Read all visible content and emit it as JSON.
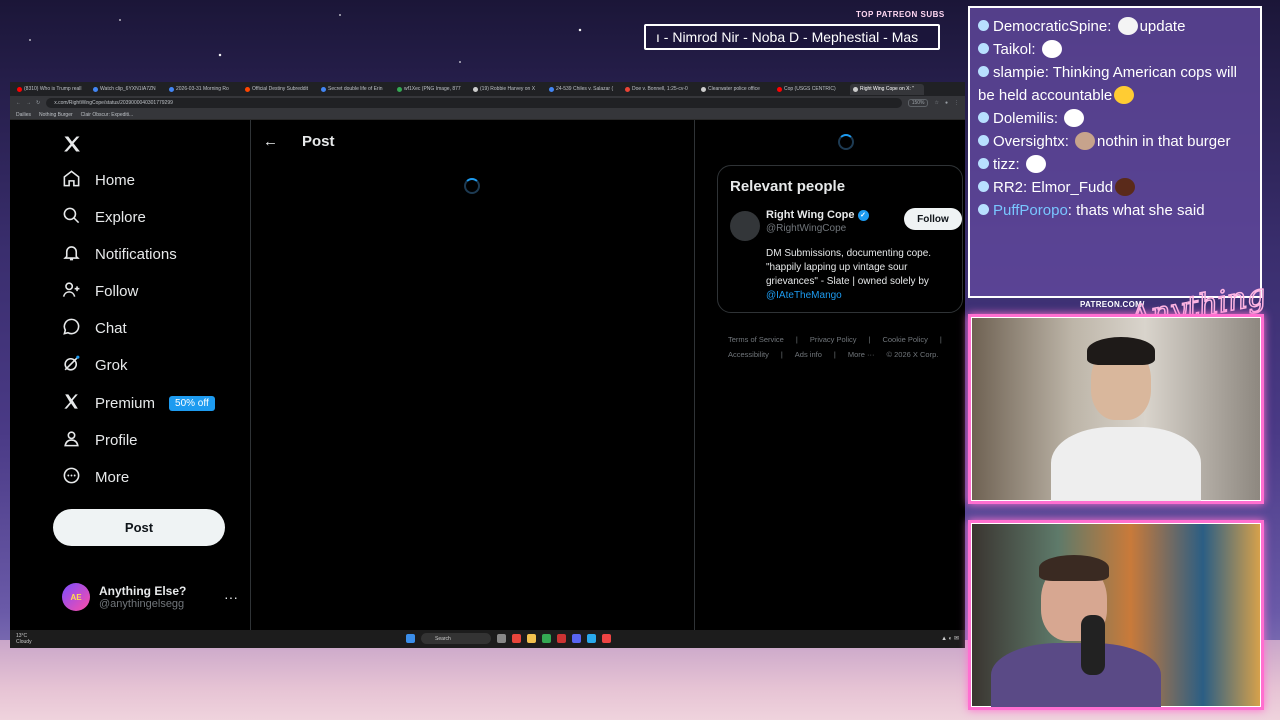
{
  "overlay": {
    "patreon_top_label": "TOP PATREON SUBS",
    "patreon_ticker": "ı - Nimrod Nir - Noba D - Mephestial - Mas",
    "patreon_url": "PATREON.COM/",
    "logo_text": "Anything Else?"
  },
  "browser": {
    "tabs": [
      {
        "label": "(8310) Who is Trump reall",
        "color": "#ff0000"
      },
      {
        "label": "Watch clip_6YXN1IA7ZN",
        "color": "#4285f4"
      },
      {
        "label": "2026-03-31 Morning Ro",
        "color": "#4285f4"
      },
      {
        "label": "Official Destiny Subreddit",
        "color": "#ff4500"
      },
      {
        "label": "Secret double life of Erin",
        "color": "#4285f4"
      },
      {
        "label": "wf1Xec (PNG Image, 877",
        "color": "#34a853"
      },
      {
        "label": "(19) Robbie Harvey on X",
        "color": "#cccccc"
      },
      {
        "label": "24-539 Chiles v. Salazar (",
        "color": "#4285f4"
      },
      {
        "label": "Doe v. Bonnell, 1:25-cv-0",
        "color": "#ea4335"
      },
      {
        "label": "Clearwater police office ",
        "color": "#cccccc"
      },
      {
        "label": "Cop (USGS CENTRIC)",
        "color": "#ff0000"
      },
      {
        "label": "Right Wing Cope on X: \"",
        "color": "#cccccc",
        "active": true
      }
    ],
    "url": "x.com/RightWingCope/status/2039000040301779299",
    "zoom": "150%",
    "bookmarks": [
      "Dailies",
      "Nothing Burger",
      "Clair Obscur: Expediti..."
    ]
  },
  "x": {
    "nav": [
      {
        "label": "Home",
        "icon": "home-icon"
      },
      {
        "label": "Explore",
        "icon": "search-icon"
      },
      {
        "label": "Notifications",
        "icon": "bell-icon"
      },
      {
        "label": "Follow",
        "icon": "follow-icon"
      },
      {
        "label": "Chat",
        "icon": "chat-icon"
      },
      {
        "label": "Grok",
        "icon": "grok-icon"
      },
      {
        "label": "Premium",
        "icon": "x-premium-icon",
        "badge": "50% off"
      },
      {
        "label": "Profile",
        "icon": "profile-icon"
      },
      {
        "label": "More",
        "icon": "more-icon"
      }
    ],
    "post_button": "Post",
    "account": {
      "name": "Anything Else?",
      "handle": "@anythingelsegg",
      "avatar_text": "AE"
    },
    "header_title": "Post",
    "relevant": {
      "title": "Relevant people",
      "name": "Right Wing Cope",
      "handle": "@RightWingCope",
      "follow": "Follow",
      "bio": "DM Submissions, documenting cope. \"happily lapping up vintage sour grievances\" - Slate | owned solely by",
      "mention": "@IAteTheMango"
    },
    "footer": [
      "Terms of Service",
      "|",
      "Privacy Policy",
      "|",
      "Cookie Policy",
      "|",
      "Accessibility",
      "|",
      "Ads info",
      "|",
      "More ···",
      "© 2026 X Corp."
    ]
  },
  "taskbar": {
    "weather_temp": "13°C",
    "weather_desc": "Cloudy",
    "search": "Search"
  },
  "chat": [
    {
      "user": "DemocraticSpine",
      "text": "update",
      "emote_before": true,
      "emote_color": "#f4f4f4"
    },
    {
      "user": "Taikol",
      "text": "",
      "emote_before": true,
      "emote_color": "#ffffff"
    },
    {
      "user": "slampie",
      "text": "Thinking American cops will be held accountable",
      "emote_after": true,
      "emote_color": "#ffcc33"
    },
    {
      "user": "Dolemilis",
      "text": "",
      "emote_before": true,
      "emote_color": "#ffffff"
    },
    {
      "user": "Oversightx",
      "text": "nothin in that burger",
      "emote_before": true,
      "emote_color": "#c7a38c"
    },
    {
      "user": "tizz",
      "text": "",
      "emote_before": true,
      "emote_color": "#ffffff"
    },
    {
      "user": "RR2",
      "text": "Elmor_Fudd",
      "emote_after": true,
      "emote_color": "#5a2a1a"
    },
    {
      "user": "PuffPoropo",
      "text": "thats what she said",
      "blue": true
    }
  ]
}
